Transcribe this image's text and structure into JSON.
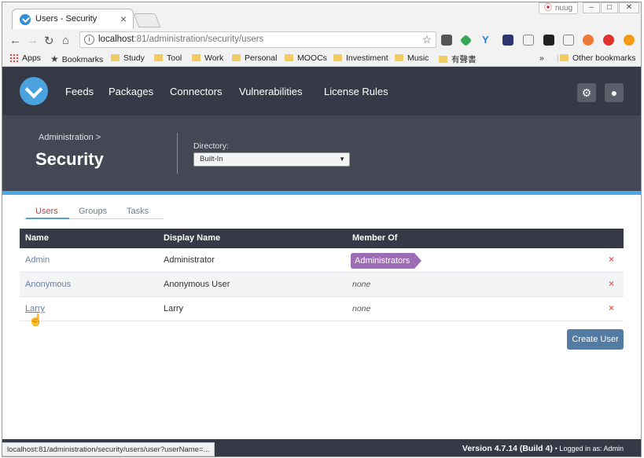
{
  "browser": {
    "tab_title": "Users - Security",
    "tab_close": "×",
    "profile_name": "nuug",
    "window_controls": [
      "–",
      "□",
      "✕"
    ],
    "url_host": "localhost",
    "url_rest": ":81/administration/security/users",
    "bookmarks": [
      {
        "label": "Apps",
        "icon": "apps-icon"
      },
      {
        "label": "Bookmarks",
        "icon": "star-icon"
      },
      {
        "label": "Study",
        "icon": "folder-icon"
      },
      {
        "label": "Tool",
        "icon": "folder-icon"
      },
      {
        "label": "Work",
        "icon": "folder-icon"
      },
      {
        "label": "Personal",
        "icon": "folder-icon"
      },
      {
        "label": "MOOCs",
        "icon": "folder-icon"
      },
      {
        "label": "Investiment",
        "icon": "folder-icon"
      },
      {
        "label": "Music",
        "icon": "folder-icon"
      },
      {
        "label": "有聲書",
        "icon": "folder-icon"
      }
    ],
    "bookmarks_overflow": "»",
    "other_bookmarks": "Other bookmarks",
    "status_url": "localhost:81/administration/security/users/user?userName=..."
  },
  "app": {
    "nav": [
      "Feeds",
      "Packages",
      "Connectors",
      "Vulnerabilities",
      "License Rules"
    ],
    "breadcrumb": "Administration >",
    "page_title": "Security",
    "directory_label": "Directory:",
    "directory_value": "Built-In",
    "subtabs": [
      "Users",
      "Groups",
      "Tasks"
    ],
    "table_headers": [
      "Name",
      "Display Name",
      "Member Of"
    ],
    "rows": [
      {
        "name": "Admin",
        "display": "Administrator",
        "member": "Administrators",
        "member_is_badge": true
      },
      {
        "name": "Anonymous",
        "display": "Anonymous User",
        "member": "none",
        "member_is_badge": false
      },
      {
        "name": "Larry",
        "display": "Larry",
        "member": "none",
        "member_is_badge": false
      }
    ],
    "delete_glyph": "×",
    "create_button": "Create User",
    "version": "Version 4.7.14 (Build 4)",
    "logged_in": "• Logged in as: Admin"
  },
  "colors": {
    "nav_bg": "#363a46",
    "header_bg": "#444855",
    "accent_blue": "#4aa8e8",
    "badge_purple": "#9c6db5",
    "button_blue": "#537ba3",
    "delete_red": "#e36a6a"
  }
}
